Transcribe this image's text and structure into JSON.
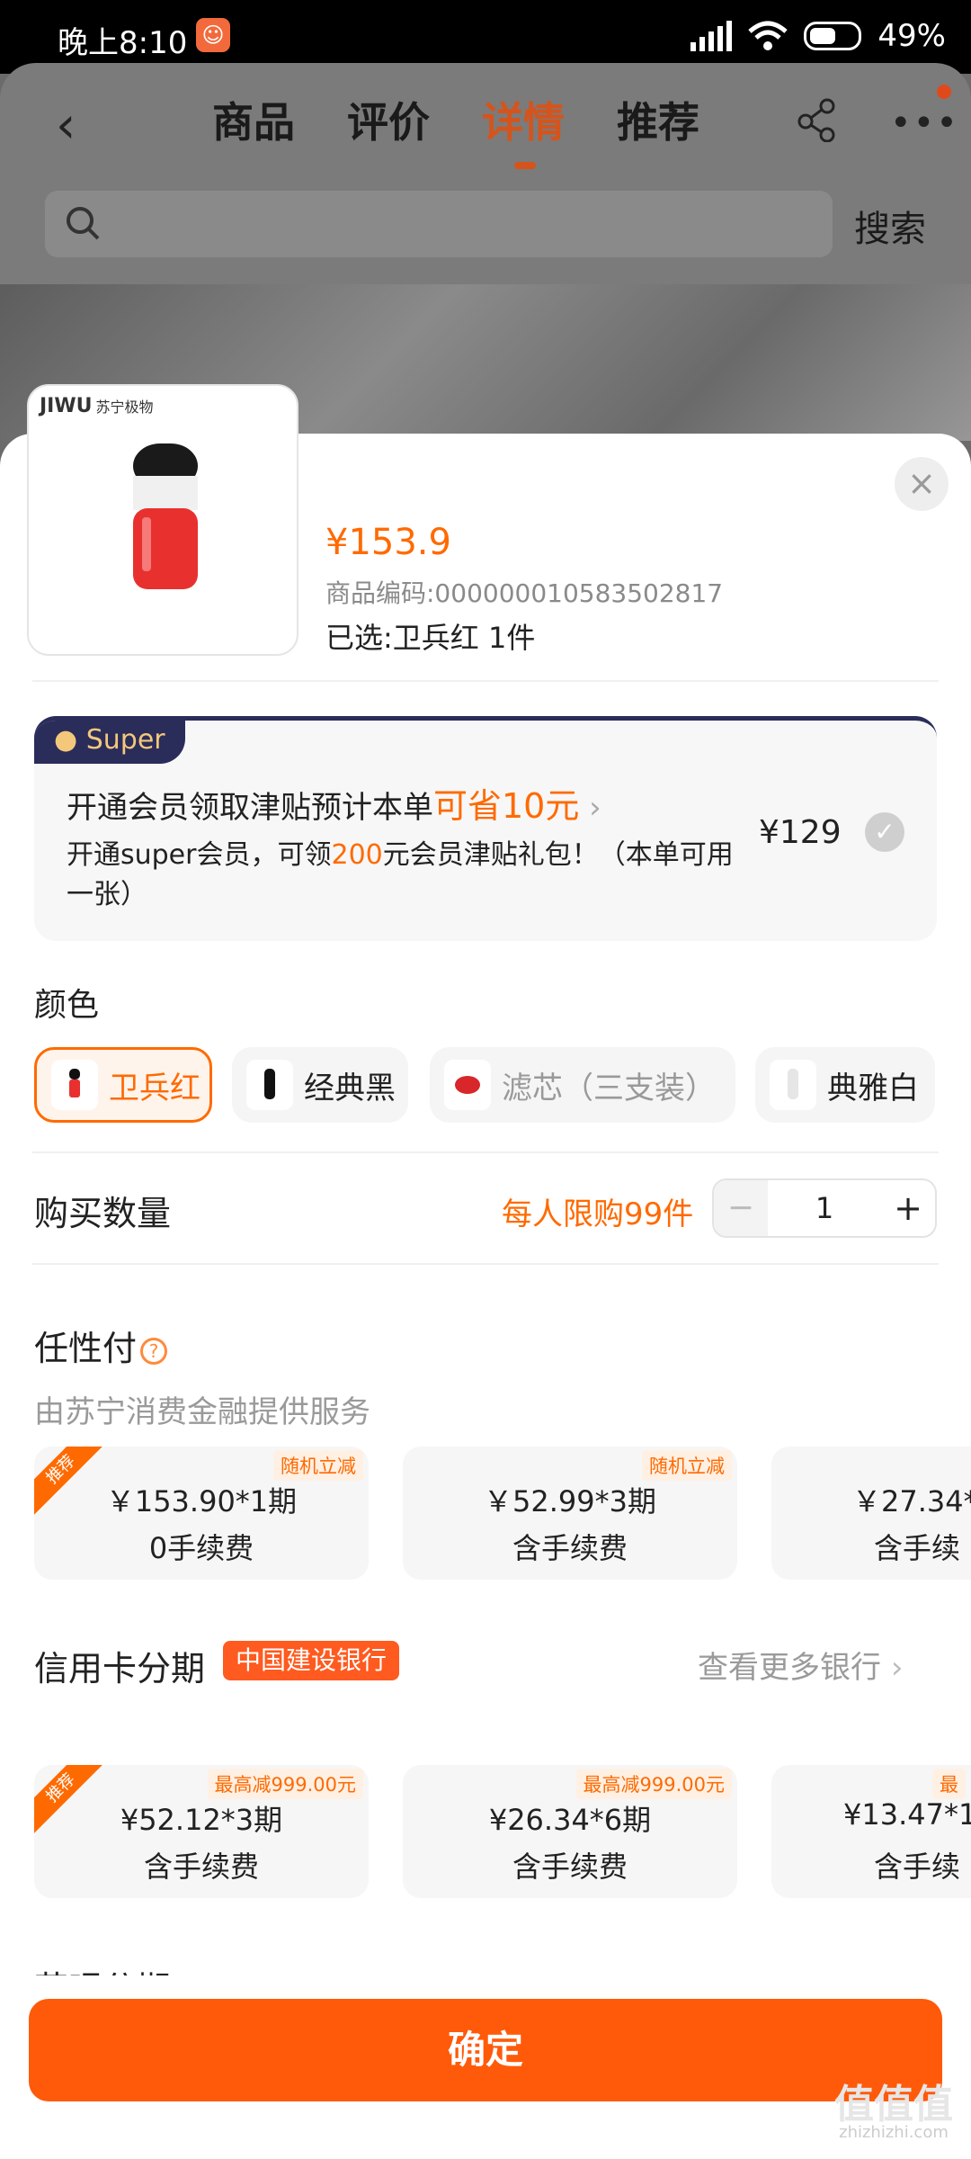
{
  "status": {
    "time": "晚上8:10",
    "battery": "49%"
  },
  "nav": {
    "tabs": [
      "商品",
      "评价",
      "详情",
      "推荐"
    ],
    "active_tab": "详情"
  },
  "search": {
    "placeholder": "",
    "button": "搜索"
  },
  "product": {
    "brand": "JIWU",
    "brand_sub": "苏宁极物",
    "price": "¥153.9",
    "code": "商品编码:000000010583502817",
    "selected": "已选:卫兵红  1件"
  },
  "super": {
    "badge": "Super",
    "line1_prefix": "开通会员领取津贴预计本单",
    "line1_highlight": "可省10元",
    "line2_a": "开通super会员，可领",
    "line2_b": "200",
    "line2_c": "元会员津贴礼包！（本单可用一张）",
    "price": "¥129"
  },
  "colors": {
    "title": "颜色",
    "options": [
      "卫兵红",
      "经典黑",
      "滤芯（三支装）",
      "典雅白"
    ],
    "selected": "卫兵红"
  },
  "quantity": {
    "title": "购买数量",
    "limit": "每人限购99件",
    "value": "1",
    "minus": "−",
    "plus": "+"
  },
  "renxingfu": {
    "title": "任性付",
    "subtitle": "由苏宁消费金融提供服务",
    "plans": [
      {
        "line1": "￥153.90*1期",
        "line2": "0手续费",
        "tag": "随机立减",
        "ribbon": "推荐"
      },
      {
        "line1": "￥52.99*3期",
        "line2": "含手续费",
        "tag": "随机立减"
      },
      {
        "line1": "￥27.34*",
        "line2": "含手续"
      }
    ]
  },
  "credit": {
    "title": "信用卡分期",
    "bank": "中国建设银行",
    "more": "查看更多银行",
    "plans": [
      {
        "line1": "¥52.12*3期",
        "line2": "含手续费",
        "tag": "最高减999.00元",
        "ribbon": "推荐"
      },
      {
        "line1": "¥26.34*6期",
        "line2": "含手续费",
        "tag": "最高减999.00元"
      },
      {
        "line1": "¥13.47*1",
        "line2": "含手续",
        "tag": "最"
      }
    ]
  },
  "huabei": {
    "title": "花呗分期"
  },
  "confirm": "确定",
  "watermark": {
    "main": "值值值",
    "sub": "zhizhizhi.com"
  }
}
